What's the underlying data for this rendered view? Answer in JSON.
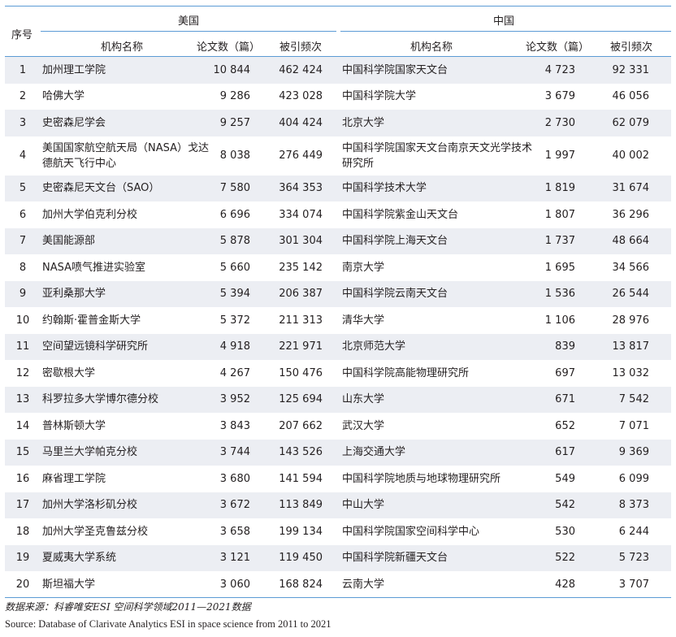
{
  "table": {
    "header": {
      "index": "序号",
      "us": "美国",
      "cn": "中国",
      "institution": "机构名称",
      "papers": "论文数（篇）",
      "citations": "被引频次"
    },
    "rows": [
      {
        "idx": "1",
        "us_name": "加州理工学院",
        "us_papers": "10 844",
        "us_cites": "462 424",
        "cn_name": "中国科学院国家天文台",
        "cn_papers": "4 723",
        "cn_cites": "92 331"
      },
      {
        "idx": "2",
        "us_name": "哈佛大学",
        "us_papers": "9 286",
        "us_cites": "423 028",
        "cn_name": "中国科学院大学",
        "cn_papers": "3 679",
        "cn_cites": "46 056"
      },
      {
        "idx": "3",
        "us_name": "史密森尼学会",
        "us_papers": "9 257",
        "us_cites": "404 424",
        "cn_name": "北京大学",
        "cn_papers": "2 730",
        "cn_cites": "62 079"
      },
      {
        "idx": "4",
        "us_name": "美国国家航空航天局（NASA）戈达德航天飞行中心",
        "us_papers": "8 038",
        "us_cites": "276 449",
        "cn_name": "中国科学院国家天文台南京天文光学技术研究所",
        "cn_papers": "1 997",
        "cn_cites": "40 002"
      },
      {
        "idx": "5",
        "us_name": "史密森尼天文台（SAO）",
        "us_papers": "7 580",
        "us_cites": "364 353",
        "cn_name": "中国科学技术大学",
        "cn_papers": "1 819",
        "cn_cites": "31 674"
      },
      {
        "idx": "6",
        "us_name": "加州大学伯克利分校",
        "us_papers": "6 696",
        "us_cites": "334 074",
        "cn_name": "中国科学院紫金山天文台",
        "cn_papers": "1 807",
        "cn_cites": "36 296"
      },
      {
        "idx": "7",
        "us_name": "美国能源部",
        "us_papers": "5 878",
        "us_cites": "301 304",
        "cn_name": "中国科学院上海天文台",
        "cn_papers": "1 737",
        "cn_cites": "48 664"
      },
      {
        "idx": "8",
        "us_name": "NASA喷气推进实验室",
        "us_papers": "5 660",
        "us_cites": "235 142",
        "cn_name": "南京大学",
        "cn_papers": "1 695",
        "cn_cites": "34 566"
      },
      {
        "idx": "9",
        "us_name": "亚利桑那大学",
        "us_papers": "5 394",
        "us_cites": "206 387",
        "cn_name": "中国科学院云南天文台",
        "cn_papers": "1 536",
        "cn_cites": "26 544"
      },
      {
        "idx": "10",
        "us_name": "约翰斯·霍普金斯大学",
        "us_papers": "5 372",
        "us_cites": "211 313",
        "cn_name": "清华大学",
        "cn_papers": "1 106",
        "cn_cites": "28 976"
      },
      {
        "idx": "11",
        "us_name": "空间望远镜科学研究所",
        "us_papers": "4 918",
        "us_cites": "221 971",
        "cn_name": "北京师范大学",
        "cn_papers": "839",
        "cn_cites": "13 817"
      },
      {
        "idx": "12",
        "us_name": "密歇根大学",
        "us_papers": "4 267",
        "us_cites": "150 476",
        "cn_name": "中国科学院高能物理研究所",
        "cn_papers": "697",
        "cn_cites": "13 032"
      },
      {
        "idx": "13",
        "us_name": "科罗拉多大学博尔德分校",
        "us_papers": "3 952",
        "us_cites": "125 694",
        "cn_name": "山东大学",
        "cn_papers": "671",
        "cn_cites": "7 542"
      },
      {
        "idx": "14",
        "us_name": "普林斯顿大学",
        "us_papers": "3 843",
        "us_cites": "207 662",
        "cn_name": "武汉大学",
        "cn_papers": "652",
        "cn_cites": "7 071"
      },
      {
        "idx": "15",
        "us_name": "马里兰大学帕克分校",
        "us_papers": "3 744",
        "us_cites": "143 526",
        "cn_name": "上海交通大学",
        "cn_papers": "617",
        "cn_cites": "9 369"
      },
      {
        "idx": "16",
        "us_name": "麻省理工学院",
        "us_papers": "3 680",
        "us_cites": "141 594",
        "cn_name": "中国科学院地质与地球物理研究所",
        "cn_papers": "549",
        "cn_cites": "6 099"
      },
      {
        "idx": "17",
        "us_name": "加州大学洛杉矶分校",
        "us_papers": "3 672",
        "us_cites": "113 849",
        "cn_name": "中山大学",
        "cn_papers": "542",
        "cn_cites": "8 373"
      },
      {
        "idx": "18",
        "us_name": "加州大学圣克鲁兹分校",
        "us_papers": "3 658",
        "us_cites": "199 134",
        "cn_name": "中国科学院国家空间科学中心",
        "cn_papers": "530",
        "cn_cites": "6 244"
      },
      {
        "idx": "19",
        "us_name": "夏威夷大学系统",
        "us_papers": "3 121",
        "us_cites": "119 450",
        "cn_name": "中国科学院新疆天文台",
        "cn_papers": "522",
        "cn_cites": "5 723"
      },
      {
        "idx": "20",
        "us_name": "斯坦福大学",
        "us_papers": "3 060",
        "us_cites": "168 824",
        "cn_name": "云南大学",
        "cn_papers": "428",
        "cn_cites": "3 707"
      }
    ]
  },
  "notes": {
    "cn": "数据来源：科睿唯安ESI 空间科学领域2011—2021数据",
    "en": "Source: Database of Clarivate Analytics ESI in space science from 2011 to 2021"
  },
  "colors": {
    "rule": "#5b9bd5",
    "stripe": "#eceef3",
    "text": "#231f20"
  }
}
